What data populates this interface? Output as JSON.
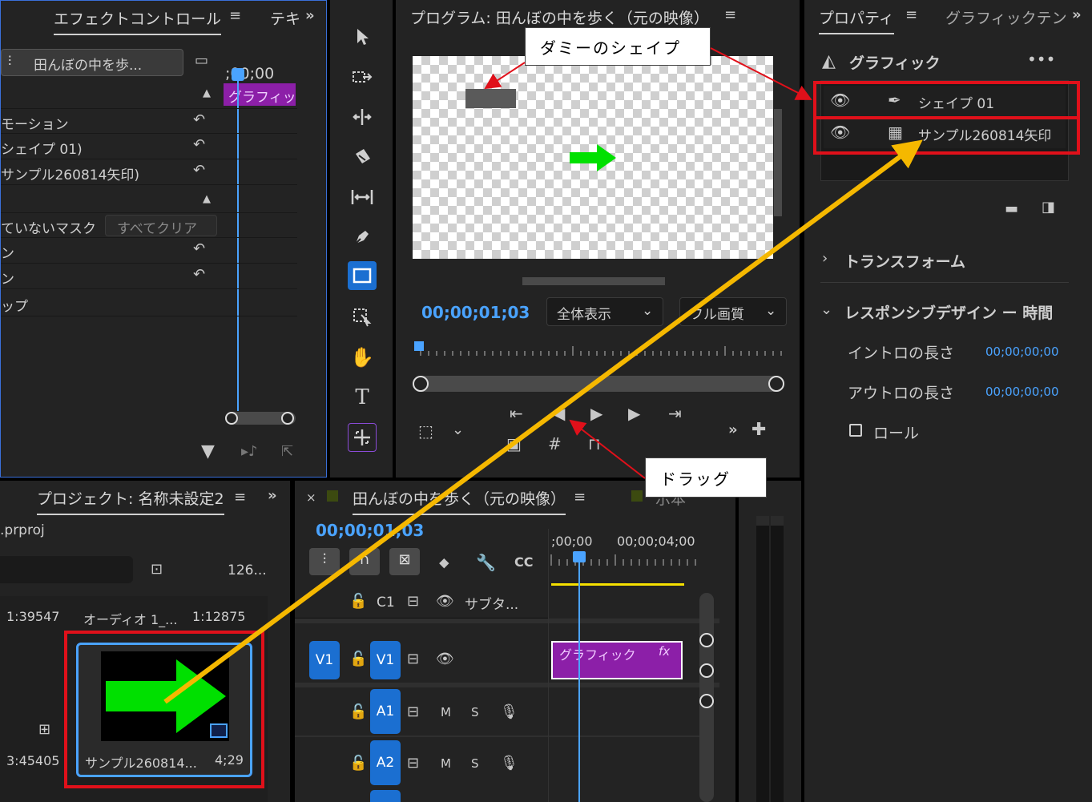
{
  "effect_panel": {
    "tab_title": "エフェクトコントロール",
    "tab2": "テキ",
    "clip_selector": "田んぼの中を歩...",
    "timecode": ";00;00",
    "clip_label": "グラフィッ",
    "rows": [
      "モーション",
      "シェイプ 01)",
      "サンプル260814矢印)",
      "ていないマスク",
      "ン",
      "ン",
      "ップ"
    ],
    "clear_all": "すべてクリア"
  },
  "program_panel": {
    "title": "プログラム: 田んぼの中を歩く（元の映像）",
    "timecode": "00;00;01;03",
    "zoom": "全体表示",
    "quality": "フル画質"
  },
  "properties_panel": {
    "tab1": "プロパティ",
    "tab2": "グラフィックテン",
    "graphic_header": "グラフィック",
    "layers": [
      {
        "name": "シェイプ 01"
      },
      {
        "name": "サンプル260814矢印"
      }
    ],
    "transform": "トランスフォーム",
    "responsive": "レスポンシブデザイン ー 時間",
    "intro_label": "イントロの長さ",
    "intro_value": "00;00;00;00",
    "outro_label": "アウトロの長さ",
    "outro_value": "00;00;00;00",
    "roll_label": "ロール"
  },
  "project_panel": {
    "title": "プロジェクト: 名称未設定2",
    "file": ".prproj",
    "count": "126...",
    "items": [
      {
        "duration": "1:39547",
        "name": "オーディオ 1_...",
        "duration2": "1:12875"
      },
      {
        "duration": "3:45405",
        "name": "サンプル260814...",
        "duration2": "4;29"
      }
    ]
  },
  "timeline_panel": {
    "title": "田んぼの中を歩く（元の映像）",
    "timecode": "00;00;01;03",
    "ruler_start": ";00;00",
    "ruler_mark": "00;00;04;00",
    "tracks": {
      "c1": "C1",
      "c1_name": "サブタ...",
      "v1": "V1",
      "a1": "A1",
      "a2": "A2",
      "m": "M",
      "s": "S"
    },
    "clip_label": "グラフィック",
    "clip_fx": "fx",
    "tab_extra": "示本"
  },
  "callouts": {
    "dummy": "ダミーのシェイプ",
    "drag": "ドラッグ"
  },
  "colors": {
    "accent_blue": "#1b6fd1",
    "timecode_blue": "#4aa3ff",
    "clip_purple": "#8c1fa8",
    "highlight_red": "#e0101a",
    "arrow_green": "#00e000",
    "drag_line": "#f5b800"
  }
}
